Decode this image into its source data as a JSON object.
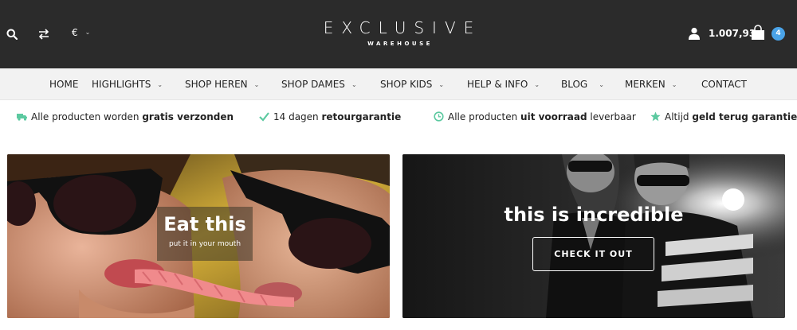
{
  "header": {
    "currency_symbol": "€",
    "logo_main": "EXCLUSIVE",
    "logo_sub": "WAREHOUSE",
    "cart_total": "1.007,93",
    "cart_count": "4",
    "accent": "#4aa3e8"
  },
  "nav": {
    "items": [
      {
        "label": "HOME"
      },
      {
        "label": "HIGHLIGHTS"
      },
      {
        "label": "SHOP HEREN"
      },
      {
        "label": "SHOP DAMES"
      },
      {
        "label": "SHOP KIDS"
      },
      {
        "label": "HELP & INFO"
      },
      {
        "label": "BLOG"
      },
      {
        "label": "MERKEN"
      },
      {
        "label": "CONTACT"
      }
    ]
  },
  "usp": {
    "icon_color": "#5cc9a0",
    "items": [
      {
        "icon": "truck-icon",
        "pre": "Alle producten worden ",
        "bold": "gratis verzonden",
        "post": ""
      },
      {
        "icon": "check-icon",
        "pre": "14 dagen ",
        "bold": "retourgarantie",
        "post": ""
      },
      {
        "icon": "clock-icon",
        "pre": "Alle producten ",
        "bold": "uit voorraad",
        "post": " leverbaar"
      },
      {
        "icon": "star-icon",
        "pre": "Altijd ",
        "bold": "geld terug garantie",
        "post": ""
      }
    ]
  },
  "banners": {
    "left": {
      "title": "Eat this",
      "subtitle": "put it in your mouth"
    },
    "right": {
      "title": "this is incredible",
      "button": "CHECK IT OUT"
    }
  }
}
